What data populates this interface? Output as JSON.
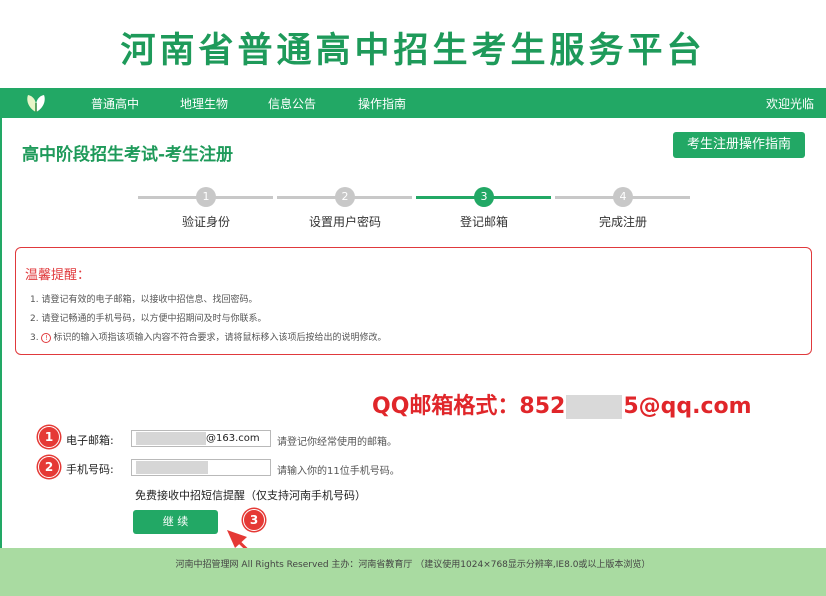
{
  "header": {
    "site_title": "河南省普通高中招生考生服务平台"
  },
  "nav": {
    "items": [
      "普通高中",
      "地理生物",
      "信息公告",
      "操作指南"
    ],
    "welcome": "欢迎光临"
  },
  "page": {
    "heading": "高中阶段招生考试-考生注册",
    "guide_button": "考生注册操作指南"
  },
  "steps": {
    "current": 3,
    "items": [
      {
        "number": "1",
        "label": "验证身份"
      },
      {
        "number": "2",
        "label": "设置用户密码"
      },
      {
        "number": "3",
        "label": "登记邮箱"
      },
      {
        "number": "4",
        "label": "完成注册"
      }
    ]
  },
  "tips": {
    "title": "温馨提醒：",
    "items": [
      "1. 请登记有效的电子邮箱，以接收中招信息、找回密码。",
      "2. 请登记畅通的手机号码，以方便中招期间及时与你联系。",
      "3. ",
      "标识的输入项指该项输入内容不符合要求，请将鼠标移入该项后按给出的说明修改。"
    ]
  },
  "annotation": {
    "qq_prefix": "QQ邮箱格式：852",
    "qq_suffix": "5@qq.com",
    "badges": [
      "1",
      "2",
      "3"
    ]
  },
  "form": {
    "email_label": "电子邮箱:",
    "email_value_suffix": "@163.com",
    "email_hint": "请登记你经常使用的邮箱。",
    "phone_label": "手机号码:",
    "phone_hint": "请输入你的11位手机号码。",
    "sms_note": "免费接收中招短信提醒（仅支持河南手机号码）",
    "continue_button": "继 续"
  },
  "footer": {
    "text": "河南中招管理网 All Rights Reserved 主办：河南省教育厅 （建议使用1024×768显示分辨率,IE8.0或以上版本浏览）"
  },
  "colors": {
    "brand_green": "#22a865",
    "alert_red": "#e0393c",
    "footer_green": "#a9dba1"
  },
  "icons": {
    "logo": "leaf-icon",
    "warning": "warning-icon",
    "arrow": "arrow-icon"
  }
}
